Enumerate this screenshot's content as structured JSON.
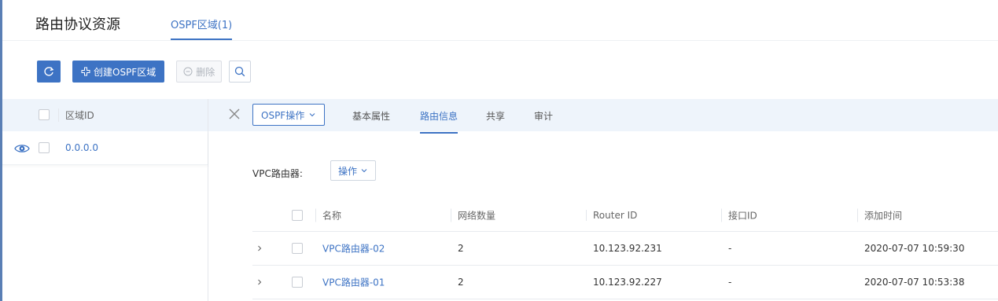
{
  "header": {
    "title": "路由协议资源",
    "tab_label": "OSPF区域(1)"
  },
  "toolbar": {
    "refresh_icon": "refresh-icon",
    "create_label": "创建OSPF区域",
    "delete_label": "删除",
    "search_icon": "search-icon"
  },
  "left_table": {
    "column_header": "区域ID",
    "rows": [
      {
        "area_id": "0.0.0.0"
      }
    ]
  },
  "detail": {
    "ospf_dropdown_label": "OSPF操作",
    "tabs": [
      {
        "label": "基本属性",
        "active": false
      },
      {
        "label": "路由信息",
        "active": true
      },
      {
        "label": "共享",
        "active": false
      },
      {
        "label": "审计",
        "active": false
      }
    ],
    "vpc_router_label": "VPC路由器:",
    "operation_dropdown_label": "操作"
  },
  "router_table": {
    "columns": [
      "名称",
      "网络数量",
      "Router ID",
      "接口ID",
      "添加时间"
    ],
    "rows": [
      {
        "name": "VPC路由器-02",
        "network_count": "2",
        "router_id": "10.123.92.231",
        "interface_id": "-",
        "added_time": "2020-07-07 10:59:30"
      },
      {
        "name": "VPC路由器-01",
        "network_count": "2",
        "router_id": "10.123.92.227",
        "interface_id": "-",
        "added_time": "2020-07-07 10:53:38"
      }
    ]
  },
  "colors": {
    "accent": "#3d73c4",
    "header_bg": "#eef4fb"
  }
}
